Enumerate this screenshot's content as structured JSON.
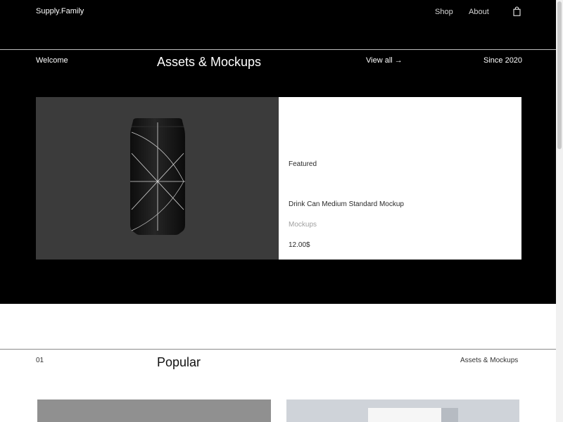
{
  "header": {
    "brand": "Supply.Family",
    "nav": [
      {
        "label": "Shop"
      },
      {
        "label": "About"
      }
    ],
    "cart_icon": "shopping-bag-icon"
  },
  "featured_section": {
    "left_label": "Welcome",
    "title": "Assets & Mockups",
    "view_all": "View all →",
    "right_label": "Since 2020",
    "card": {
      "tag": "Featured",
      "name": "Drink Can Medium Standard Mockup",
      "category": "Mockups",
      "price": "12.00$",
      "image_icon": "drink-can-image"
    }
  },
  "popular_section": {
    "number": "01",
    "title": "Popular",
    "category": "Assets & Mockups"
  },
  "colors": {
    "hero_bg": "#000000",
    "card_image_bg": "#3b3b3b",
    "muted_text": "#a0a0a0"
  }
}
